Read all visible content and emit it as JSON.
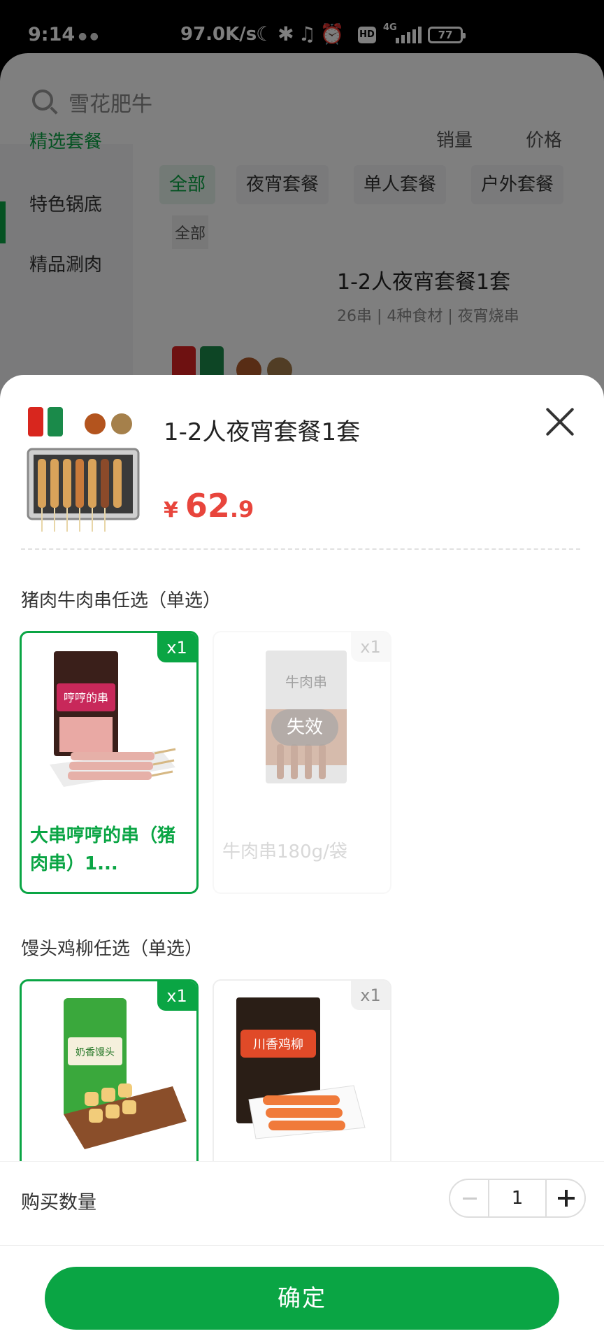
{
  "status_bar": {
    "time": "9:14",
    "speed": "97.0K/s",
    "network": "4G",
    "hd": "HD",
    "battery": "77"
  },
  "background": {
    "search_placeholder": "雪花肥牛",
    "sidebar": [
      "精选套餐",
      "特色锅底",
      "精品涮肉"
    ],
    "sort": [
      "销量",
      "价格"
    ],
    "tabs": [
      "全部",
      "夜宵套餐",
      "单人套餐",
      "户外套餐"
    ],
    "subtab": "全部",
    "product_title": "1-2人夜宵套餐1套",
    "product_sub": "26串 | 4种食材 | 夜宵烧串"
  },
  "sheet": {
    "title": "1-2人夜宵套餐1套",
    "price_currency": "¥",
    "price_int": "62",
    "price_dec": ".9",
    "groups": [
      {
        "title": "猪肉牛肉串任选（单选）",
        "items": [
          {
            "badge": "x1",
            "name": "大串哼哼的串（猪肉串）1...",
            "state": "selected"
          },
          {
            "badge": "x1",
            "name": "牛肉串180g/袋",
            "state": "disabled",
            "tag": "失效"
          }
        ]
      },
      {
        "title": "馒头鸡柳任选（单选）",
        "items": [
          {
            "badge": "x1",
            "name": "",
            "state": "selected"
          },
          {
            "badge": "x1",
            "name": "",
            "state": "normal"
          }
        ]
      }
    ],
    "quantity_label": "购买数量",
    "quantity": "1",
    "confirm": "确定"
  },
  "colors": {
    "accent": "#0aa544",
    "price": "#e8453c"
  }
}
